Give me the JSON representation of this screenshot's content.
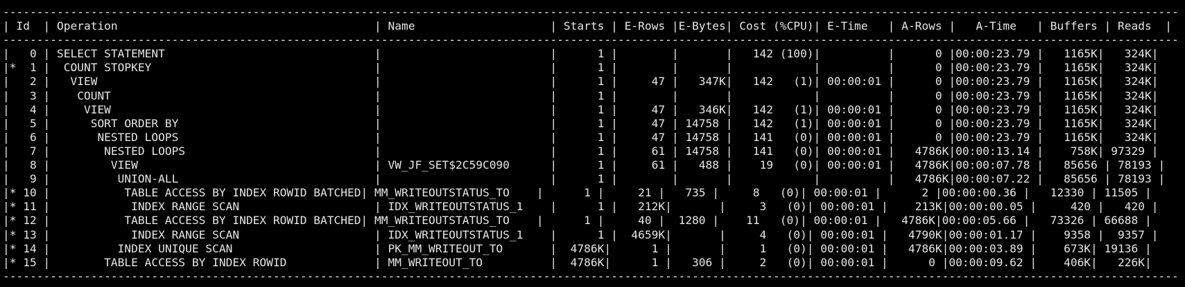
{
  "terminal": {
    "lines": [
      "------------------------------------------------------------------------------------------------------------------------------------------------------------------------------",
      "| Id  | Operation                                      | Name                    | Starts | E-Rows |E-Bytes| Cost (%CPU)| E-Time   | A-Rows |   A-Time   | Buffers | Reads  |",
      "------------------------------------------------------------------------------------------------------------------------------------------------------------------------------",
      "|   0 | SELECT STATEMENT                               |                         |      1 |        |       |   142 (100)|          |      0 |00:00:23.79 |   1165K|   324K|",
      "|*  1 |  COUNT STOPKEY                                 |                         |      1 |        |       |            |          |      0 |00:00:23.79 |   1165K|   324K|",
      "|   2 |   VIEW                                         |                         |      1 |     47 |   347K|   142   (1)| 00:00:01 |      0 |00:00:23.79 |   1165K|   324K|",
      "|   3 |    COUNT                                       |                         |      1 |        |       |            |          |      0 |00:00:23.79 |   1165K|   324K|",
      "|   4 |     VIEW                                       |                         |      1 |     47 |   346K|   142   (1)| 00:00:01 |      0 |00:00:23.79 |   1165K|   324K|",
      "|   5 |      SORT ORDER BY                             |                         |      1 |     47 | 14758 |   142   (1)| 00:00:01 |      0 |00:00:23.79 |   1165K|   324K|",
      "|   6 |       NESTED LOOPS                             |                         |      1 |     47 | 14758 |   141   (0)| 00:00:01 |      0 |00:00:23.79 |   1165K|   324K|",
      "|   7 |        NESTED LOOPS                            |                         |      1 |     61 | 14758 |   141   (0)| 00:00:01 |   4786K|00:00:13.14 |    758K| 97329 |",
      "|   8 |         VIEW                                   | VW_JF_SET$2C59C090      |      1 |     61 |   488 |    19   (0)| 00:00:01 |   4786K|00:00:07.78 |   85656 | 78193 |",
      "|   9 |          UNION-ALL                             |                         |      1 |        |       |            |          |   4786K|00:00:07.22 |   85656 | 78193 |",
      "|* 10 |           TABLE ACCESS BY INDEX ROWID BATCHED| MM_WRITEOUTSTATUS_TO    |      1 |     21 |   735 |     8   (0)| 00:00:01 |      2 |00:00:00.36 |   12330 | 11505 |",
      "|* 11 |            INDEX RANGE SCAN                    | IDX_WRITEOUTSTATUS_1    |      1 |   212K|       |     3   (0)| 00:00:01 |    213K|00:00:00.05 |     420 |   420 |",
      "|* 12 |           TABLE ACCESS BY INDEX ROWID BATCHED| MM_WRITEOUTSTATUS_TO    |      1 |     40 |  1280 |    11   (0)| 00:00:01 |   4786K|00:00:05.66 |   73326 | 66688 |",
      "|* 13 |            INDEX RANGE SCAN                    | IDX_WRITEOUTSTATUS_1    |      1 |  4659K|       |     4   (0)| 00:00:01 |   4790K|00:00:01.17 |    9358 |  9357 |",
      "|* 14 |          INDEX UNIQUE SCAN                     | PK_MM_WRITEOUT_TO       |  4786K|      1 |       |     1   (0)| 00:00:01 |   4786K|00:00:03.89 |    673K| 19136 |",
      "|* 15 |        TABLE ACCESS BY INDEX ROWID             | MM_WRITEOUT_TO          |  4786K|      1 |   306 |     2   (0)| 00:00:01 |      0 |00:00:09.62 |    406K|   226K|",
      "------------------------------------------------------------------------------------------------------------------------------------------------------------------------------"
    ]
  }
}
